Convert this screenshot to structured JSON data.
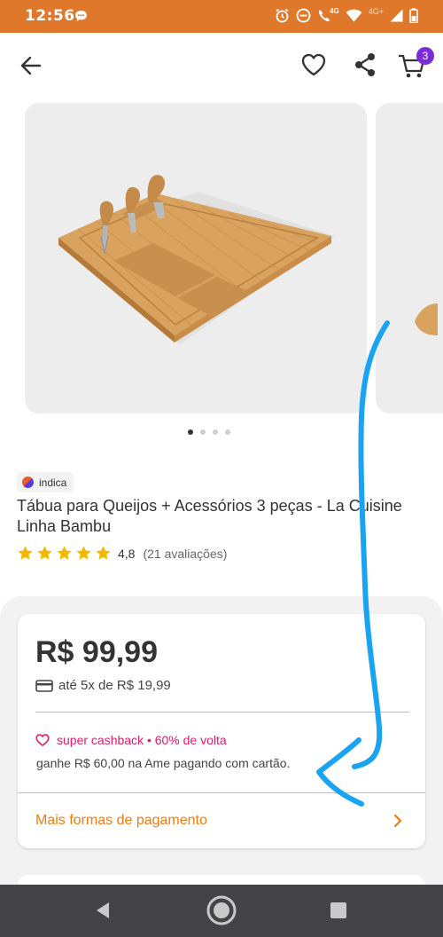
{
  "status_bar": {
    "time": "12:56",
    "network_label": "4G",
    "network2_label": "4G+",
    "icons": [
      "chat-bubble-icon",
      "alarm-icon",
      "do-not-disturb-icon",
      "call-4g-icon",
      "wifi-icon",
      "signal-icon",
      "battery-icon"
    ]
  },
  "header": {
    "icons": [
      "back-arrow-icon",
      "heart-icon",
      "share-icon",
      "cart-icon"
    ],
    "cart_count": "3"
  },
  "gallery": {
    "image_description": "bamboo cheese board with knives",
    "dots_total": 4,
    "dots_active": 0
  },
  "product": {
    "seller": "indica",
    "title_line1": "Tábua para Queijos + Acessórios 3 peças - La Cuisine",
    "title_line2": "Linha Bambu",
    "rating_value": "4,8",
    "rating_count": "(21 avaliações)",
    "stars": 5
  },
  "price": {
    "main": "R$ 99,99",
    "installments": "até 5x de R$ 19,99",
    "cashback_label": "super cashback • 60% de volta",
    "cashback_note": "ganhe R$ 60,00 na Ame pagando com cartão.",
    "more_payments": "Mais formas de pagamento"
  },
  "colors": {
    "status_bar": "#e0782c",
    "accent_orange": "#f07b12",
    "cashback_pink": "#e6196b",
    "badge_purple": "#7b2cd6",
    "star_yellow": "#f5b800",
    "annotation_blue": "#1aa3f0",
    "nav_bar": "#444446"
  }
}
